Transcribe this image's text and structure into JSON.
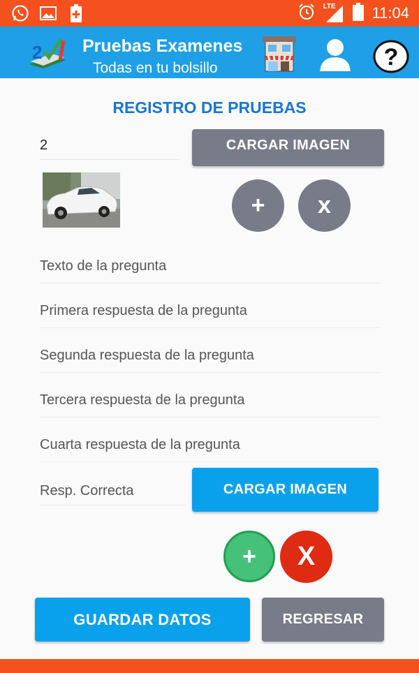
{
  "status_bar": {
    "time": "11:04",
    "network": "LTE",
    "icons": [
      "whatsapp-icon",
      "gallery-icon",
      "battery-saver-icon",
      "alarm-icon",
      "signal-icon",
      "battery-icon"
    ]
  },
  "app_bar": {
    "title": "Pruebas Examenes",
    "subtitle": "Todas en tu bolsillo",
    "icons": [
      "app-logo-icon",
      "store-icon",
      "user-icon",
      "help-icon"
    ]
  },
  "form": {
    "heading": "REGISTRO DE PRUEBAS",
    "number_value": "2",
    "load_image_label": "CARGAR IMAGEN",
    "add_symbol": "+",
    "remove_symbol": "x",
    "question_placeholder": "Texto de la pregunta",
    "answer1_placeholder": "Primera respuesta de la pregunta",
    "answer2_placeholder": "Segunda respuesta de la pregunta",
    "answer3_placeholder": "Tercera respuesta de la pregunta",
    "answer4_placeholder": "Cuarta respuesta de la pregunta",
    "correct_placeholder": "Resp. Correcta",
    "load_image2_label": "CARGAR IMAGEN",
    "add2_symbol": "+",
    "remove2_symbol": "X"
  },
  "actions": {
    "save_label": "GUARDAR DATOS",
    "back_label": "REGRESAR"
  },
  "colors": {
    "status_bar": "#f4511e",
    "app_bar": "#1e9fe6",
    "heading": "#1976d2",
    "button_blue": "#0aa1ec",
    "button_gray": "#787b88",
    "green": "#46c17a",
    "red": "#de2b12"
  }
}
